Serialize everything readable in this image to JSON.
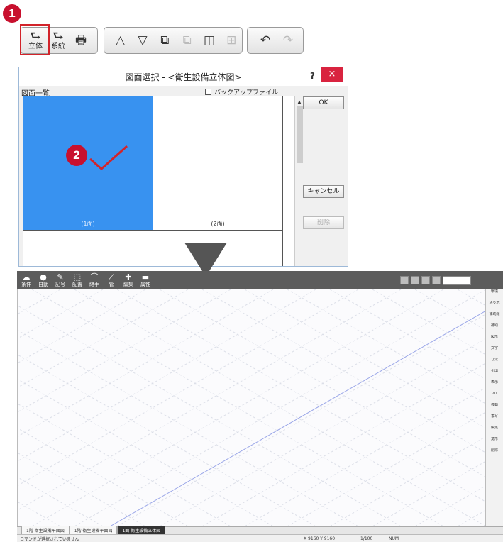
{
  "toolbar": {
    "group1": [
      {
        "name": "3d-view-button",
        "icon": "rotate-3d-icon",
        "glyph": "⮑",
        "label": "立体"
      },
      {
        "name": "related-button",
        "icon": "link-icon",
        "glyph": "⮑",
        "label": "系統"
      },
      {
        "name": "print-button",
        "icon": "printer-icon",
        "glyph": "🖶",
        "label": ""
      }
    ],
    "group2": [
      {
        "name": "up-floor-button",
        "icon": "triangle-up-icon",
        "glyph": "△"
      },
      {
        "name": "down-floor-button",
        "icon": "triangle-down-icon",
        "glyph": "▽"
      },
      {
        "name": "window-cascade-button",
        "icon": "cascade-windows-icon",
        "glyph": "⧉"
      },
      {
        "name": "window-copy-button",
        "icon": "copy-window-icon",
        "glyph": "⧉"
      },
      {
        "name": "split-vertical-button",
        "icon": "split-vertical-icon",
        "glyph": "◫"
      },
      {
        "name": "split-quad-button",
        "icon": "split-quad-icon",
        "glyph": "⊞"
      }
    ],
    "group3": [
      {
        "name": "undo-button",
        "icon": "undo-icon",
        "glyph": "↶"
      },
      {
        "name": "redo-button",
        "icon": "redo-icon",
        "glyph": "↷"
      }
    ]
  },
  "step1": "1",
  "step2": "2",
  "dialog": {
    "title": "図面選択 - <衛生設備立体図>",
    "help": "?",
    "close": "×",
    "list_label": "図面一覧",
    "backup_label": "バックアップファイル",
    "ok": "OK",
    "cancel": "キャンセル",
    "delete": "削除",
    "cells": [
      {
        "caption": "(1面)",
        "selected": true
      },
      {
        "caption": "(2面)",
        "selected": false
      },
      {
        "caption": "",
        "selected": false
      },
      {
        "caption": "",
        "selected": false
      }
    ]
  },
  "app": {
    "tools": [
      {
        "name": "condition-tool",
        "glyph": "☁",
        "label": "条件"
      },
      {
        "name": "auto-tool",
        "glyph": "●",
        "label": "自動"
      },
      {
        "name": "symbol-tool",
        "glyph": "✎",
        "label": "記号"
      },
      {
        "name": "place-tool",
        "glyph": "⬚",
        "label": "配置"
      },
      {
        "name": "fitting-tool",
        "glyph": "⌒",
        "label": "継手"
      },
      {
        "name": "pipe-tool",
        "glyph": "⟋",
        "label": "管"
      },
      {
        "name": "edit-tool",
        "glyph": "✚",
        "label": "編集"
      },
      {
        "name": "attribute-tool",
        "glyph": "▬",
        "label": "属性"
      }
    ],
    "right_panel": [
      "環境",
      "通り芯",
      "補助線",
      "補助",
      "図形",
      "文字",
      "寸法",
      "引出",
      "表示",
      "2D",
      "移動",
      "複写",
      "編集",
      "変形",
      "削除"
    ],
    "tabs": [
      {
        "label": "1階 衛生設備平面図",
        "active": false
      },
      {
        "label": "1階 衛生設備平面図",
        "active": false
      },
      {
        "label": "1面 衛生設備立体図",
        "active": true
      }
    ],
    "status_left": "コマンドが選択されていません",
    "status_coords": "X 9160 Y 9160",
    "status_scale": "1/100",
    "status_snap": "NUM"
  }
}
